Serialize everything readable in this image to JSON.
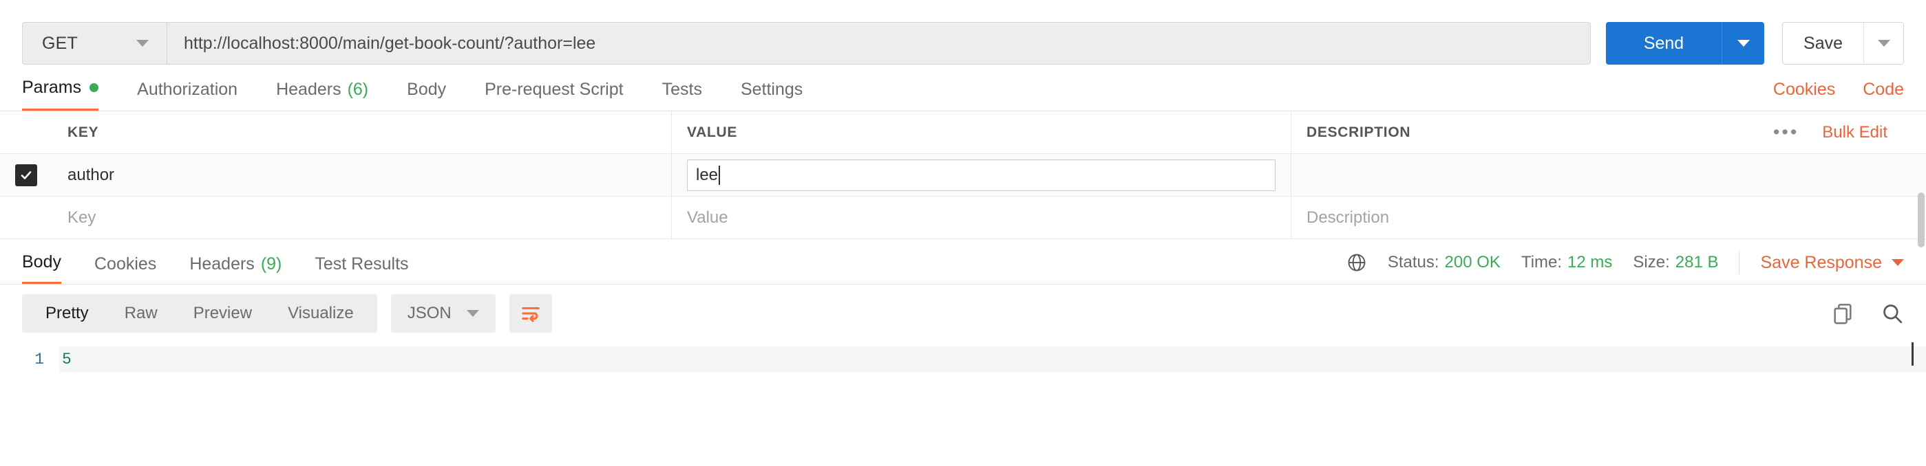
{
  "request": {
    "method": "GET",
    "url": "http://localhost:8000/main/get-book-count/?author=lee",
    "send_label": "Send",
    "save_label": "Save",
    "tabs": [
      {
        "label": "Params",
        "badge": "",
        "dot": true,
        "active": true
      },
      {
        "label": "Authorization",
        "badge": "",
        "dot": false,
        "active": false
      },
      {
        "label": "Headers",
        "badge": "(6)",
        "dot": false,
        "active": false
      },
      {
        "label": "Body",
        "badge": "",
        "dot": false,
        "active": false
      },
      {
        "label": "Pre-request Script",
        "badge": "",
        "dot": false,
        "active": false
      },
      {
        "label": "Tests",
        "badge": "",
        "dot": false,
        "active": false
      },
      {
        "label": "Settings",
        "badge": "",
        "dot": false,
        "active": false
      }
    ],
    "right_links": [
      {
        "label": "Cookies"
      },
      {
        "label": "Code"
      }
    ]
  },
  "params": {
    "headers": {
      "key": "KEY",
      "value": "VALUE",
      "description": "DESCRIPTION"
    },
    "bulk_edit_label": "Bulk Edit",
    "dots_label": "•••",
    "rows": [
      {
        "checked": true,
        "key": "author",
        "value": "lee",
        "description": "",
        "focused": true
      }
    ],
    "placeholders": {
      "key": "Key",
      "value": "Value",
      "description": "Description"
    }
  },
  "response": {
    "tabs": [
      {
        "label": "Body",
        "badge": "",
        "active": true
      },
      {
        "label": "Cookies",
        "badge": "",
        "active": false
      },
      {
        "label": "Headers",
        "badge": "(9)",
        "active": false
      },
      {
        "label": "Test Results",
        "badge": "",
        "active": false
      }
    ],
    "status_label": "Status:",
    "status_value": "200 OK",
    "time_label": "Time:",
    "time_value": "12 ms",
    "size_label": "Size:",
    "size_value": "281 B",
    "save_response_label": "Save Response",
    "format_pills": [
      {
        "label": "Pretty",
        "active": true
      },
      {
        "label": "Raw",
        "active": false
      },
      {
        "label": "Preview",
        "active": false
      },
      {
        "label": "Visualize",
        "active": false
      }
    ],
    "format_type": "JSON",
    "body_lines": [
      {
        "number": "1",
        "text": "5"
      }
    ]
  },
  "colors": {
    "accent_orange": "#ff6c37",
    "link_orange": "#e8663a",
    "send_blue": "#1a76d2",
    "success_green": "#3bab5a",
    "json_value_green": "#12805c",
    "line_number_blue": "#3c6e8f"
  }
}
